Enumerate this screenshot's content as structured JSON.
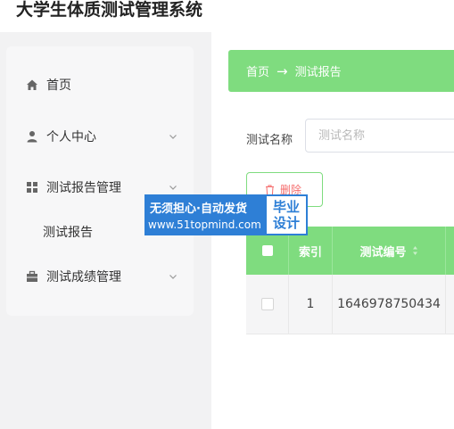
{
  "app": {
    "title": "大学生体质测试管理系统"
  },
  "sidebar": {
    "items": [
      {
        "label": "首页",
        "icon": "home-icon"
      },
      {
        "label": "个人中心",
        "icon": "user-icon"
      },
      {
        "label": "测试报告管理",
        "icon": "grid-icon"
      },
      {
        "label": "测试报告"
      },
      {
        "label": "测试成绩管理",
        "icon": "briefcase-icon"
      }
    ]
  },
  "breadcrumb": {
    "home": "首页",
    "arrow": "→",
    "current": "测试报告"
  },
  "search": {
    "label": "测试名称",
    "placeholder": "测试名称",
    "value": ""
  },
  "toolbar": {
    "delete_label": "删除"
  },
  "table": {
    "headers": {
      "index": "索引",
      "test_no": "测试编号"
    },
    "rows": [
      {
        "index": "1",
        "test_no": "1646978750434"
      }
    ]
  },
  "watermark": {
    "line1": "无须担心·自动发货",
    "line2": "www.51topmind.com",
    "badge_line1": "毕业",
    "badge_line2": "设计"
  },
  "colors": {
    "accent": "#7fdc7f",
    "danger": "#f56c6c",
    "watermark_blue": "#2e7fd6"
  }
}
